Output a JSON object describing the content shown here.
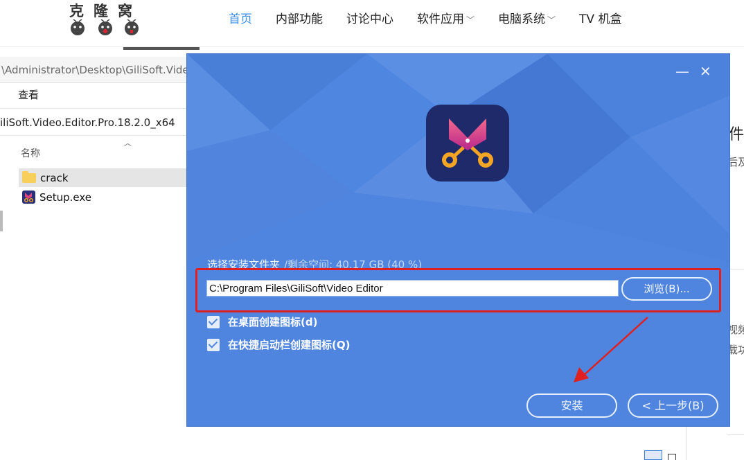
{
  "site": {
    "logo_text": "克隆窝",
    "nav": [
      {
        "label": "首页",
        "active": true
      },
      {
        "label": "内部功能"
      },
      {
        "label": "讨论中心"
      },
      {
        "label": "软件应用",
        "dropdown": true
      },
      {
        "label": "电脑系统",
        "dropdown": true
      },
      {
        "label": "TV 机盒"
      }
    ],
    "chevron_icon": "chevron-down-icon",
    "active_color": "#3a8ee6"
  },
  "explorer": {
    "address": "\\Administrator\\Desktop\\GiliSoft.Video",
    "ribbon_view": "查看",
    "folder_title": "iliSoft.Video.Editor.Pro.18.2.0_x64",
    "column_name": "名称",
    "files": [
      {
        "name": "crack",
        "icon": "folder-icon",
        "selected": true
      },
      {
        "name": "Setup.exe",
        "icon": "app-exe-icon",
        "selected": false
      }
    ]
  },
  "right_page": {
    "fragments": [
      "件",
      "后及",
      "视频",
      "载功"
    ]
  },
  "installer": {
    "minimize_glyph": "—",
    "close_glyph": "✕",
    "path_label": "选择安装文件夹",
    "free_space": "/剩余空间: 40.17 GB (40 %)",
    "install_path": "C:\\Program Files\\GiliSoft\\Video Editor",
    "browse_label": "浏览(B)...",
    "checkboxes": [
      {
        "label": "在桌面创建图标(d)",
        "checked": true
      },
      {
        "label": "在快捷启动栏创建图标(Q)",
        "checked": true
      }
    ],
    "install_label": "安装",
    "back_label": "< 上一步(B)",
    "bg_color": "#4f85de",
    "highlight_color": "#e02020"
  }
}
